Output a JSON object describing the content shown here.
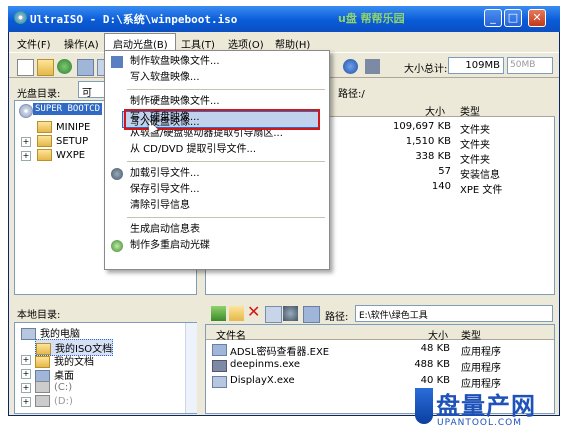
{
  "window": {
    "title": "UltraISO - D:\\系统\\winpeboot.iso",
    "watermark": "u盘 帮帮乐园",
    "controls": {
      "minimize": "_",
      "maximize": "□",
      "close": "✕"
    }
  },
  "menubar": {
    "items": [
      "文件(F)",
      "操作(A)",
      "启动光盘(B)",
      "工具(T)",
      "选项(O)",
      "帮助(H)"
    ]
  },
  "toolbar": {
    "size_label": "大小总计:",
    "size_value": "109MB",
    "size_bar_text": "50MB"
  },
  "image_dir": {
    "label": "光盘目录:",
    "value": "可",
    "path_label": "路径:/"
  },
  "tree_top": {
    "root": "SUPER BOOTCD",
    "items": [
      "MINIPE",
      "SETUP",
      "WXPE"
    ]
  },
  "list_top": {
    "headers": {
      "size": "大小",
      "type": "类型"
    },
    "rows": [
      {
        "size": "109,697 KB",
        "type": "文件夹"
      },
      {
        "size": "1,510 KB",
        "type": "文件夹"
      },
      {
        "size": "338 KB",
        "type": "文件夹"
      },
      {
        "size": "57",
        "type": "安装信息"
      },
      {
        "size": "140",
        "type": "XPE 文件"
      }
    ]
  },
  "dropdown": {
    "items": [
      "制作软盘映像文件...",
      "写入软盘映像...",
      "制作硬盘映像文件...",
      "写入硬盘映像...",
      "从软盘/硬盘驱动器提取引导扇区...",
      "从 CD/DVD 提取引导文件...",
      "加载引导文件...",
      "保存引导文件...",
      "清除引导信息",
      "生成启动信息表",
      "制作多重启动光碟"
    ]
  },
  "local": {
    "label": "本地目录:",
    "path_label": "路径:",
    "path_value": "E:\\软件\\绿色工具",
    "tree": [
      "我的电脑",
      "我的ISO文档",
      "我的文档",
      "桌面",
      "(C:)",
      "(D:)"
    ],
    "headers": {
      "name": "文件名",
      "size": "大小",
      "type": "类型"
    },
    "files": [
      {
        "name": "ADSL密码查看器.EXE",
        "size": "48 KB",
        "type": "应用程序"
      },
      {
        "name": "deepinms.exe",
        "size": "488 KB",
        "type": "应用程序"
      },
      {
        "name": "DisplayX.exe",
        "size": "40 KB",
        "type": "应用程序"
      }
    ]
  },
  "logo": {
    "text": "盘量产网",
    "sub": "UPANTOOL.COM"
  },
  "colors": {
    "title_bar": "#0a5bd8",
    "selection": "#316ac5",
    "highlight_border": "#d11818",
    "logo_blue": "#1d52b8"
  }
}
